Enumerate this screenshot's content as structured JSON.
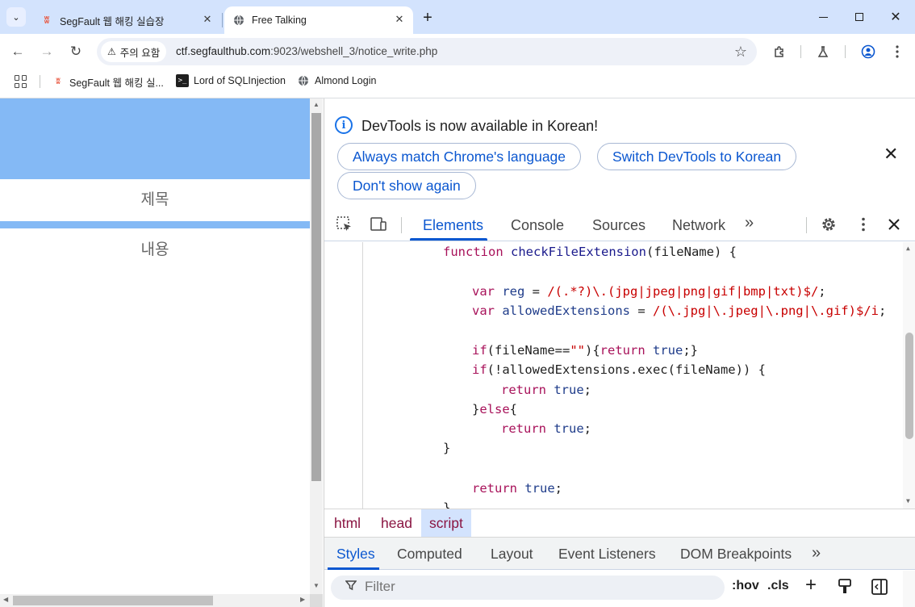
{
  "browser": {
    "tab_search_icon": "chevron-down-icon",
    "tabs": [
      {
        "title": "SegFault 웹 해킹 실습장",
        "close": "✕",
        "active": false
      },
      {
        "title": "Free Talking",
        "close": "✕",
        "active": true
      }
    ],
    "new_tab": "+",
    "window_controls": {
      "close": "✕"
    }
  },
  "toolbar": {
    "back": "←",
    "forward": "→",
    "reload": "↻",
    "security_chip": "주의 요함",
    "security_icon": "⚠",
    "url_host": "ctf.segfaulthub.com",
    "url_rest": ":9023/webshell_3/notice_write.php",
    "star": "☆"
  },
  "bookmarks": [
    {
      "label": "SegFault 웹 해킹 실...",
      "icon": "segfault-icon"
    },
    {
      "label": "Lord of SQLInjection",
      "icon": "terminal-icon"
    },
    {
      "label": "Almond Login",
      "icon": "globe-icon"
    }
  ],
  "page": {
    "field_title": "제목",
    "field_content": "내용"
  },
  "devtools": {
    "infobar": {
      "message": "DevTools is now available in Korean!",
      "btn_match": "Always match Chrome's language",
      "btn_switch": "Switch DevTools to Korean",
      "btn_dont_show": "Don't show again",
      "close": "✕"
    },
    "tabs": [
      "Elements",
      "Console",
      "Sources",
      "Network"
    ],
    "active_tab": "Elements",
    "more_tabs": "»",
    "code_lines": [
      {
        "kw": "function",
        "fn": "checkFileExtension",
        "rest": "(fileName) {"
      },
      {
        "blank": true
      },
      {
        "kw": "var",
        "id": "reg",
        "eq": " = ",
        "rx": "/(.*?)\\.(jpg|jpeg|png|gif|bmp|txt)$/",
        "end": ";"
      },
      {
        "kw": "var",
        "id": "allowedExtensions",
        "eq": " = ",
        "rx": "/(\\.jpg|\\.jpeg|\\.png|\\.gif)$/i",
        "end": ";"
      },
      {
        "blank": true
      },
      {
        "text": "if(fileName==\"\"){return true;}"
      },
      {
        "text": "if(!allowedExtensions.exec(fileName)) {"
      },
      {
        "text": "return true;"
      },
      {
        "text": "}else{"
      },
      {
        "text": "return true;"
      },
      {
        "text": "}"
      },
      {
        "blank": true
      },
      {
        "text": "return true;"
      },
      {
        "text": "}"
      }
    ],
    "breadcrumbs": [
      "html",
      "head",
      "script"
    ],
    "selected_crumb": "script",
    "sub_tabs": [
      "Styles",
      "Computed",
      "Layout",
      "Event Listeners",
      "DOM Breakpoints"
    ],
    "active_sub_tab": "Styles",
    "sub_more": "»",
    "filter_placeholder": "Filter",
    "filter_hov": ":hov",
    "filter_cls": ".cls",
    "filter_add": "+"
  },
  "colors": {
    "tabstrip": "#d3e3fd",
    "page_accent": "#84b9f5",
    "devtools_accent": "#0b57d0"
  }
}
